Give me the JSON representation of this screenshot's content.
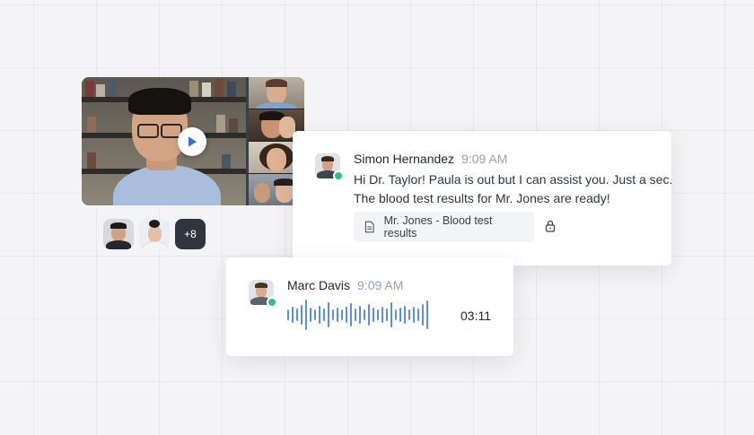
{
  "video_call": {
    "play_icon": "play-icon",
    "participants_more": "+8"
  },
  "message_1": {
    "sender": "Simon Hernandez",
    "time": "9:09 AM",
    "line1": "Hi Dr. Taylor! Paula is out but I can assist you. Just a sec.",
    "line2": "The blood test results for Mr. Jones are ready!",
    "attachment": "Mr. Jones - Blood test results",
    "attachment_icon": "document-icon",
    "lock_icon": "lock-icon"
  },
  "message_2": {
    "sender": "Marc Davis",
    "time": "9:09 AM",
    "voice_duration": "03:11"
  },
  "colors": {
    "accent": "#5b8fe6",
    "online": "#2ec27e",
    "more_badge": "#2f343d"
  }
}
